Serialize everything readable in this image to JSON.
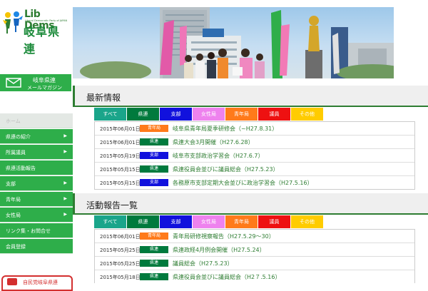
{
  "brand": {
    "logo_name": "Lib Dems",
    "logo_sub": "Liberal Democratic Party of JAPAN",
    "logo_kanji": "岐阜県連"
  },
  "mail_button": {
    "line1": "岐阜県連",
    "line2": "メールマガジン",
    "icon": "envelope-icon"
  },
  "sidebar": {
    "items": [
      {
        "label": "ホーム",
        "arrow": false
      },
      {
        "label": "県連の紹介",
        "arrow": true
      },
      {
        "label": "所属議員",
        "arrow": true
      },
      {
        "label": "県連活動報告",
        "arrow": false
      },
      {
        "label": "支部",
        "arrow": true
      },
      {
        "label": "青年局",
        "arrow": true
      },
      {
        "label": "女性局",
        "arrow": true
      },
      {
        "label": "リンク集・お問合せ",
        "arrow": false
      },
      {
        "label": "会員登録",
        "arrow": false
      }
    ]
  },
  "bottom_banner": {
    "label": "自民党岐阜県連"
  },
  "section1": {
    "title": "最新情報",
    "tabs": [
      {
        "label": "すべて",
        "color": "#1aa58a"
      },
      {
        "label": "県連",
        "color": "#007a3d"
      },
      {
        "label": "支部",
        "color": "#1111dd"
      },
      {
        "label": "女性局",
        "color": "#ee82ee"
      },
      {
        "label": "青年局",
        "color": "#ff7a1a"
      },
      {
        "label": "議員",
        "color": "#ee1111"
      },
      {
        "label": "その他",
        "color": "#ffcc00"
      }
    ],
    "rows": [
      {
        "date": "2015年06月01日",
        "badge": "青年局",
        "badge_color": "#ff7a1a",
        "title": "岐阜県青年局夏季研修会（~H27.8.31）"
      },
      {
        "date": "2015年06月01日",
        "badge": "県連",
        "badge_color": "#007a3d",
        "title": "県連大会3月開催（H27.6.28）"
      },
      {
        "date": "2015年05月19日",
        "badge": "支部",
        "badge_color": "#1111dd",
        "title": "岐阜市支部政治学習会（H27.6.7）"
      },
      {
        "date": "2015年05月15日",
        "badge": "県連",
        "badge_color": "#007a3d",
        "title": "県連役員会並びに議員総会（H27.5.23）"
      },
      {
        "date": "2015年05月15日",
        "badge": "支部",
        "badge_color": "#1111dd",
        "title": "各務原市支部定期大会並びに政治学習会（H27.5.16）"
      }
    ]
  },
  "section2": {
    "title": "活動報告一覧",
    "tabs": [
      {
        "label": "すべて",
        "color": "#1aa58a"
      },
      {
        "label": "県連",
        "color": "#007a3d"
      },
      {
        "label": "支部",
        "color": "#1111dd"
      },
      {
        "label": "女性局",
        "color": "#ee82ee"
      },
      {
        "label": "青年局",
        "color": "#ff7a1a"
      },
      {
        "label": "議員",
        "color": "#ee1111"
      },
      {
        "label": "その他",
        "color": "#ffcc00"
      }
    ],
    "rows": [
      {
        "date": "2015年06月01日",
        "badge": "青年局",
        "badge_color": "#ff7a1a",
        "title": "青年局研修視察報告（H27.5.29～30）"
      },
      {
        "date": "2015年05月25日",
        "badge": "県連",
        "badge_color": "#007a3d",
        "title": "県連政経4月例会開催（H27.5.24）"
      },
      {
        "date": "2015年05月25日",
        "badge": "県連",
        "badge_color": "#007a3d",
        "title": "議員総会（H27.5.23）"
      },
      {
        "date": "2015年05月18日",
        "badge": "県連",
        "badge_color": "#007a3d",
        "title": "県連役員会並びに議員総会（H2７.5.16）"
      }
    ]
  }
}
